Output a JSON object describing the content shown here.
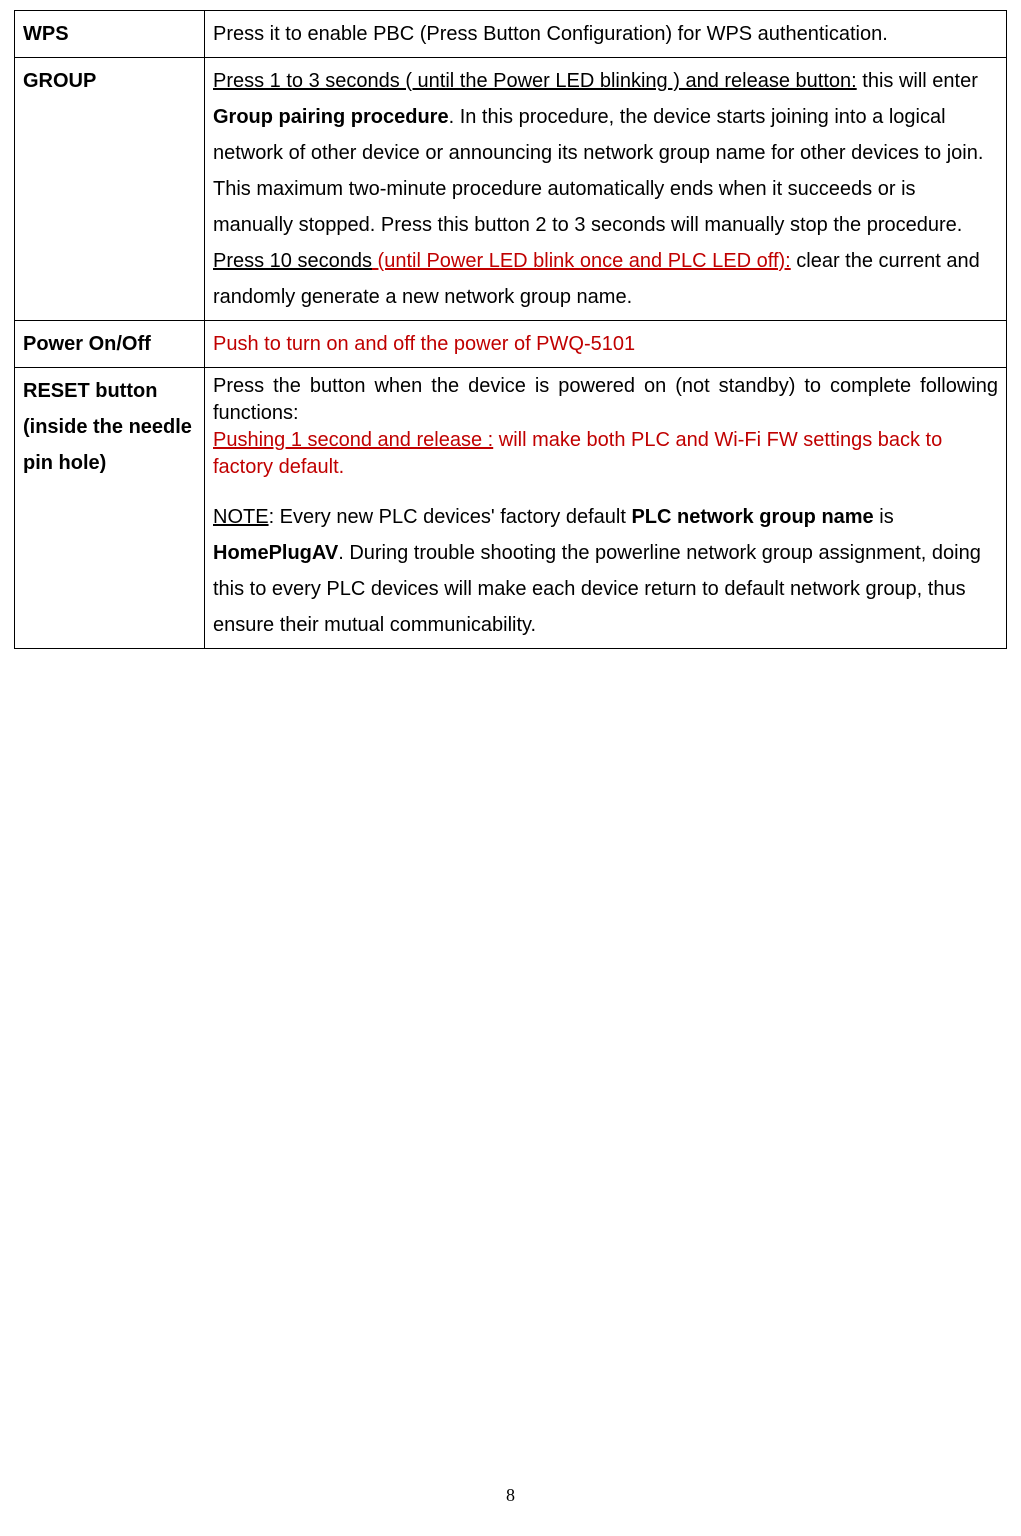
{
  "rows": {
    "wps": {
      "label": "WPS",
      "desc": "Press it to enable PBC (Press Button Configuration) for WPS authentication."
    },
    "group": {
      "label": "GROUP",
      "press1_underline": "Press 1 to 3 seconds ( until the Power LED blinking ) and release button:",
      "press1_after": " this will enter ",
      "press1_bold": "Group pairing procedure",
      "press1_rest": ". In this procedure, the device starts joining into a logical network of other device or announcing its network group name for other devices to join. This maximum two-minute procedure automatically ends when it succeeds or is manually stopped. Press this button 2 to 3 seconds will manually stop the procedure.",
      "press10_prefix": "Press 10 seconds",
      "press10_red_underline": " (until Power LED blink once and PLC LED off):",
      "press10_rest": " clear the current and randomly generate a new network group name."
    },
    "power": {
      "label": "Power On/Off",
      "desc": "Push to turn on and off the power of PWQ-5101"
    },
    "reset": {
      "label_line1": "RESET button",
      "label_line2": "(inside the needle pin hole)",
      "intro": "Press the button when the device is powered on (not standby) to complete following functions:",
      "push1_underline": "Pushing 1 second and release :",
      "push1_rest": " will make both PLC and Wi-Fi FW settings back to factory default.",
      "note_label": "NOTE",
      "note_after": ": Every new PLC devices' factory default ",
      "note_bold1": "PLC network group name",
      "note_mid": " is ",
      "note_bold2": "HomePlugAV",
      "note_rest": ". During trouble shooting the powerline network group assignment, doing this to every PLC devices will make each device return to default network group, thus ensure their mutual communicability."
    }
  },
  "page_number": "8"
}
